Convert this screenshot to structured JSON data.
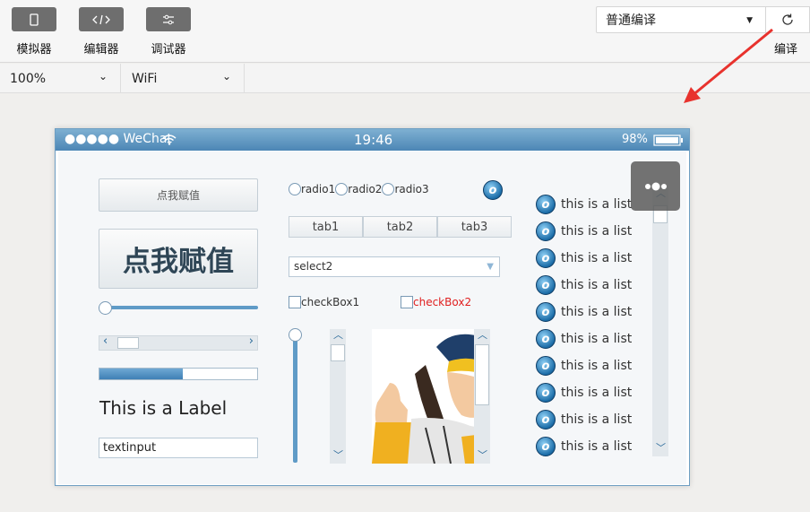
{
  "toolbar": {
    "simulator_label": "模拟器",
    "editor_label": "编辑器",
    "debugger_label": "调试器",
    "compile_mode": "普通编译",
    "compile_label": "编译"
  },
  "subbar": {
    "zoom": "100%",
    "network": "WiFi"
  },
  "status_bar": {
    "carrier": "●●●●● WeChat",
    "time": "19:46",
    "battery": "98%"
  },
  "screen": {
    "small_button": "点我赋值",
    "big_button": "点我赋值",
    "label": "This is a Label",
    "textinput_value": "textinput",
    "progress": 0.53,
    "radios": [
      "radio1",
      "radio2",
      "radio3"
    ],
    "tabs": [
      "tab1",
      "tab2",
      "tab3"
    ],
    "select_value": "select2",
    "checkbox1": "checkBox1",
    "checkbox2": "checkBox2",
    "checkbox2_color": "#e02020",
    "list_items": [
      "this is a list",
      "this is a list",
      "this is a list",
      "this is a list",
      "this is a list",
      "this is a list",
      "this is a list",
      "this is a list",
      "this is a list",
      "this is a list"
    ]
  },
  "colors": {
    "status_bar": "#5a92bf",
    "accent": "#4d8dbf",
    "arrow": "#e8322d"
  }
}
